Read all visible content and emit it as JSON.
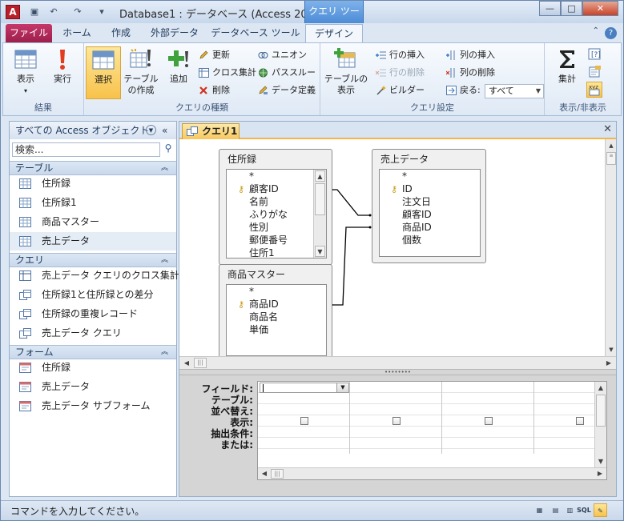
{
  "window": {
    "title": "Database1 : データベース (Access 200...",
    "context_tab": "クエリ ツール",
    "quick_access": [
      "save-icon",
      "undo-icon",
      "redo-icon",
      "customize-icon"
    ],
    "controls": {
      "minimize": "—",
      "maximize": "□",
      "close": "✕"
    }
  },
  "ribbon": {
    "file_tab": "ファイル",
    "tabs": [
      "ホーム",
      "作成",
      "外部データ",
      "データベース ツール",
      "デザイン"
    ],
    "active_tab": "デザイン",
    "groups": {
      "results": {
        "label": "結果",
        "view": "表示",
        "run": "実行"
      },
      "query_type": {
        "label": "クエリの種類",
        "select": "選択",
        "make_table": "テーブルの作成",
        "append": "追加",
        "update": "更新",
        "crosstab": "クロス集計",
        "delete": "削除",
        "union": "ユニオン",
        "pass_through": "パススルー",
        "data_definition": "データ定義"
      },
      "query_setup": {
        "label": "クエリ設定",
        "show_table": "テーブルの表示",
        "insert_rows": "行の挿入",
        "delete_rows": "行の削除",
        "builder": "ビルダー",
        "insert_columns": "列の挿入",
        "delete_columns": "列の削除",
        "return_label": "戻る:",
        "return_value": "すべて"
      },
      "show_hide": {
        "label": "表示/非表示",
        "totals": "集計"
      }
    }
  },
  "nav_pane": {
    "title": "すべての Access オブジェクト",
    "search_placeholder": "検索...",
    "sections": [
      {
        "name": "テーブル",
        "items": [
          "住所録",
          "住所録1",
          "商品マスター",
          "売上データ"
        ]
      },
      {
        "name": "クエリ",
        "items": [
          "売上データ クエリのクロス集計",
          "住所録1と住所録との差分",
          "住所録の重複レコード",
          "売上データ クエリ"
        ]
      },
      {
        "name": "フォーム",
        "items": [
          "住所録",
          "売上データ",
          "売上データ サブフォーム"
        ]
      }
    ],
    "selected_item": "売上データ"
  },
  "document": {
    "tab_label": "クエリ1",
    "tables": [
      {
        "name": "住所録",
        "fields": [
          "*",
          "顧客ID",
          "名前",
          "ふりがな",
          "性別",
          "郵便番号",
          "住所1"
        ],
        "key_field": "顧客ID"
      },
      {
        "name": "売上データ",
        "fields": [
          "*",
          "ID",
          "注文日",
          "顧客ID",
          "商品ID",
          "個数"
        ],
        "key_field": "ID"
      },
      {
        "name": "商品マスター",
        "fields": [
          "*",
          "商品ID",
          "商品名",
          "単価"
        ],
        "key_field": "商品ID"
      }
    ],
    "grid_row_labels": [
      "フィールド:",
      "テーブル:",
      "並べ替え:",
      "表示:",
      "抽出条件:",
      "または:"
    ],
    "grid_columns": 4,
    "show_checked": [
      false,
      false,
      false,
      false
    ]
  },
  "status_bar": {
    "text": "コマンドを入力してください。",
    "view_buttons": [
      "datasheet-view-icon",
      "pivot-table-icon",
      "pivot-chart-icon",
      "SQL",
      "design-view-icon"
    ]
  },
  "colors": {
    "accent": "#f8c24a",
    "file_tab": "#b52a5c",
    "context_tab": "#5b96dc"
  }
}
